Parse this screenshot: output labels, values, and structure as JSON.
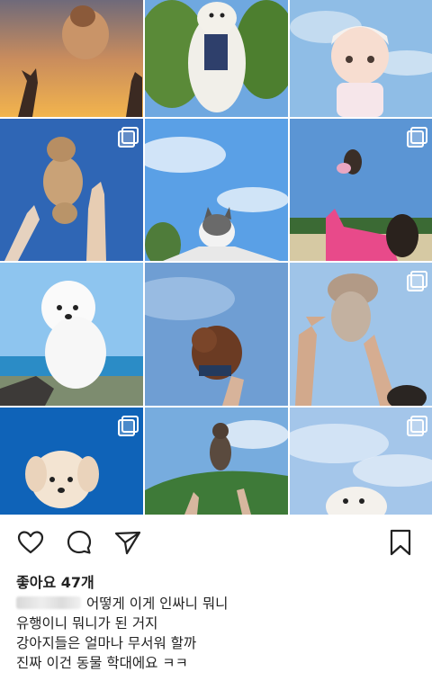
{
  "feed": {
    "tiles": [
      {
        "icon": "sunset-puppy-photo",
        "multi": false
      },
      {
        "icon": "tree-puppy-photo",
        "multi": false
      },
      {
        "icon": "doll-photo",
        "multi": false
      },
      {
        "icon": "poodle-toss-photo",
        "multi": true
      },
      {
        "icon": "cat-photo",
        "multi": false
      },
      {
        "icon": "dog-toss-photo",
        "multi": true
      },
      {
        "icon": "bichon-photo",
        "multi": false
      },
      {
        "icon": "brown-poodle-photo",
        "multi": false
      },
      {
        "icon": "grey-poodle-photo",
        "multi": true
      },
      {
        "icon": "maltese-photo",
        "multi": true
      },
      {
        "icon": "hill-dog-photo",
        "multi": false
      },
      {
        "icon": "cloud-dog-photo",
        "multi": true
      }
    ]
  },
  "post": {
    "likes": "좋아요 47개",
    "caption": {
      "line1": "어떻게 이게 인싸니 뭐니",
      "line2": "유행이니 뭐니가 된 거지",
      "line3": "강아지들은 얼마나 무서워 할까",
      "line4": "진짜 이건 동물 학대에요 ㅋㅋ"
    }
  },
  "colors": {
    "icon_stroke": "#222222",
    "sky": "#6fa6dc",
    "grass": "#3f7a3b"
  }
}
